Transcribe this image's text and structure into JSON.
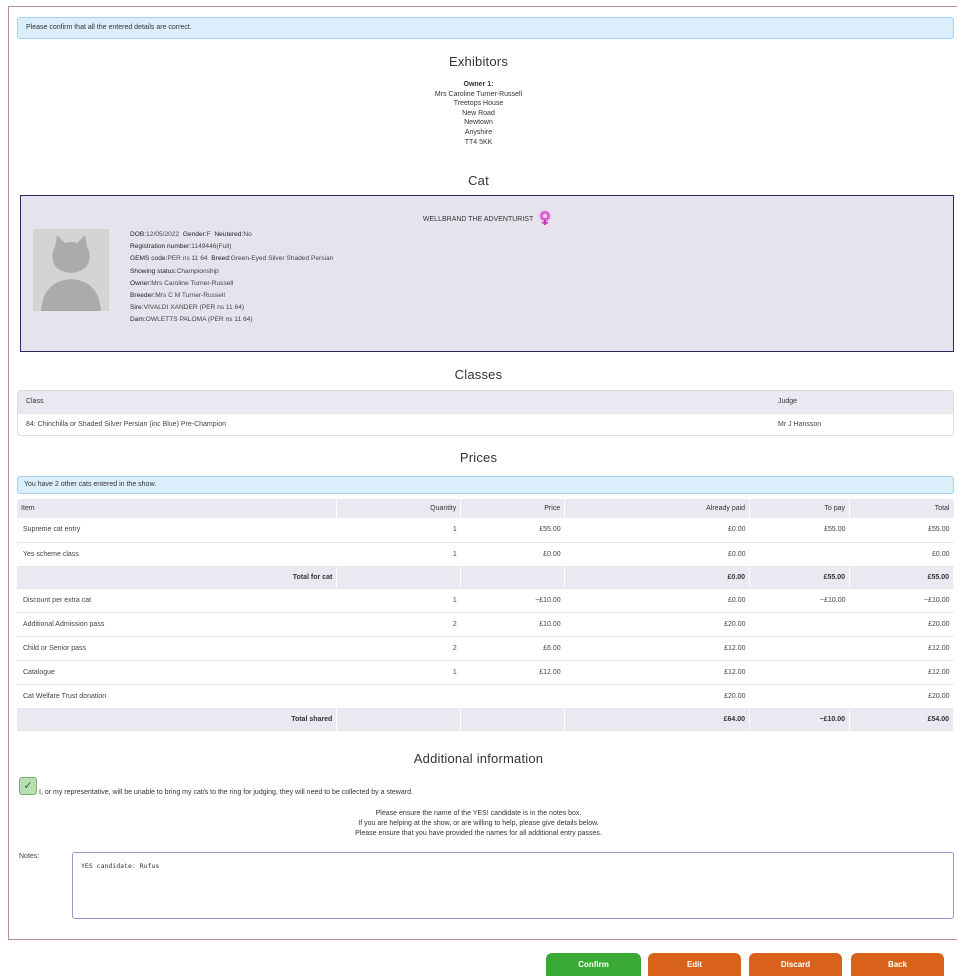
{
  "alert": "Please confirm that all the entered details are correct.",
  "exhibitors": {
    "heading": "Exhibitors",
    "owner_label": "Owner 1:",
    "lines": [
      "Mrs Caroline Turner-Russell",
      "Treetops House",
      "New Road",
      "Newtown",
      "Anyshire",
      "TT4 5KK"
    ]
  },
  "cat": {
    "heading": "Cat",
    "name": "WELLBRAND THE ADVENTURIST",
    "gender_icon": "female-icon",
    "details": {
      "dob_label": "DOB:",
      "dob": "12/05/2022",
      "gender_label": "Gender:",
      "gender": "F",
      "neutered_label": "Neutered:",
      "neutered": "No",
      "reg_label": "Registration number:",
      "reg": "1149446(Full)",
      "gems_label": "GEMS code:",
      "gems": "PER ns 11 64",
      "breed_label": "Breed:",
      "breed": "Green-Eyed Silver Shaded Persian",
      "status_label": "Showing status:",
      "status": "Championship",
      "owner_label": "Owner:",
      "owner": "Mrs Caroline Turner-Russell",
      "breeder_label": "Breeder:",
      "breeder": "Mrs C M Turner-Russell",
      "sire_label": "Sire:",
      "sire": "VIVALDI XANDER (PER ns 11 64)",
      "dam_label": "Dam:",
      "dam": "OWLETTS PALOMA (PER ns 11 64)"
    }
  },
  "classes": {
    "heading": "Classes",
    "col_class": "Class",
    "col_judge": "Judge",
    "rows": [
      {
        "class": "84: Chinchilla or Shaded Silver Persian (inc Blue) Pre-Champion",
        "judge": "Mr J Hansson"
      }
    ]
  },
  "prices": {
    "heading": "Prices",
    "note": "You have 2 other cats entered in the show.",
    "columns": [
      "Item",
      "Quantity",
      "Price",
      "Already paid",
      "To pay",
      "Total"
    ],
    "rows": [
      [
        "Supreme cat entry",
        "1",
        "£55.00",
        "£0.00",
        "£55.00",
        "£55.00"
      ],
      [
        "Yes scheme class",
        "1",
        "£0.00",
        "£0.00",
        "",
        "£0.00"
      ]
    ],
    "cat_total": [
      "Total for cat",
      "",
      "",
      "£0.00",
      "£55.00",
      "£55.00"
    ],
    "shared_rows": [
      [
        "Discount per extra cat",
        "1",
        "−£10.00",
        "£0.00",
        "−£10.00",
        "−£10.00"
      ],
      [
        "Additional Admission pass",
        "2",
        "£10.00",
        "£20.00",
        "",
        "£20.00"
      ],
      [
        "Child or Senior pass",
        "2",
        "£6.00",
        "£12.00",
        "",
        "£12.00"
      ],
      [
        "Catalogue",
        "1",
        "£12.00",
        "£12.00",
        "",
        "£12.00"
      ],
      [
        "Cat Welfare Trust donation",
        "",
        "",
        "£20.00",
        "",
        "£20.00"
      ]
    ],
    "shared_total": [
      "Total shared",
      "",
      "",
      "£64.00",
      "−£10.00",
      "£54.00"
    ]
  },
  "additional": {
    "heading": "Additional information",
    "checkbox_label": "I, or my representative, will be unable to bring my cat/s to the ring for judging, they will need to be collected by a steward.",
    "lines": [
      "Please ensure the name of the YES! candidate is in the notes box.",
      "If you are helping at the show, or are willing to help, please give details below.",
      "Please ensure that you have provided the names for all additional entry passes."
    ],
    "notes_label": "Notes:",
    "notes_value": "YES candidate: Rufus"
  },
  "buttons": {
    "confirm": "Confirm",
    "edit": "Edit",
    "discard": "Discard",
    "back": "Back"
  }
}
